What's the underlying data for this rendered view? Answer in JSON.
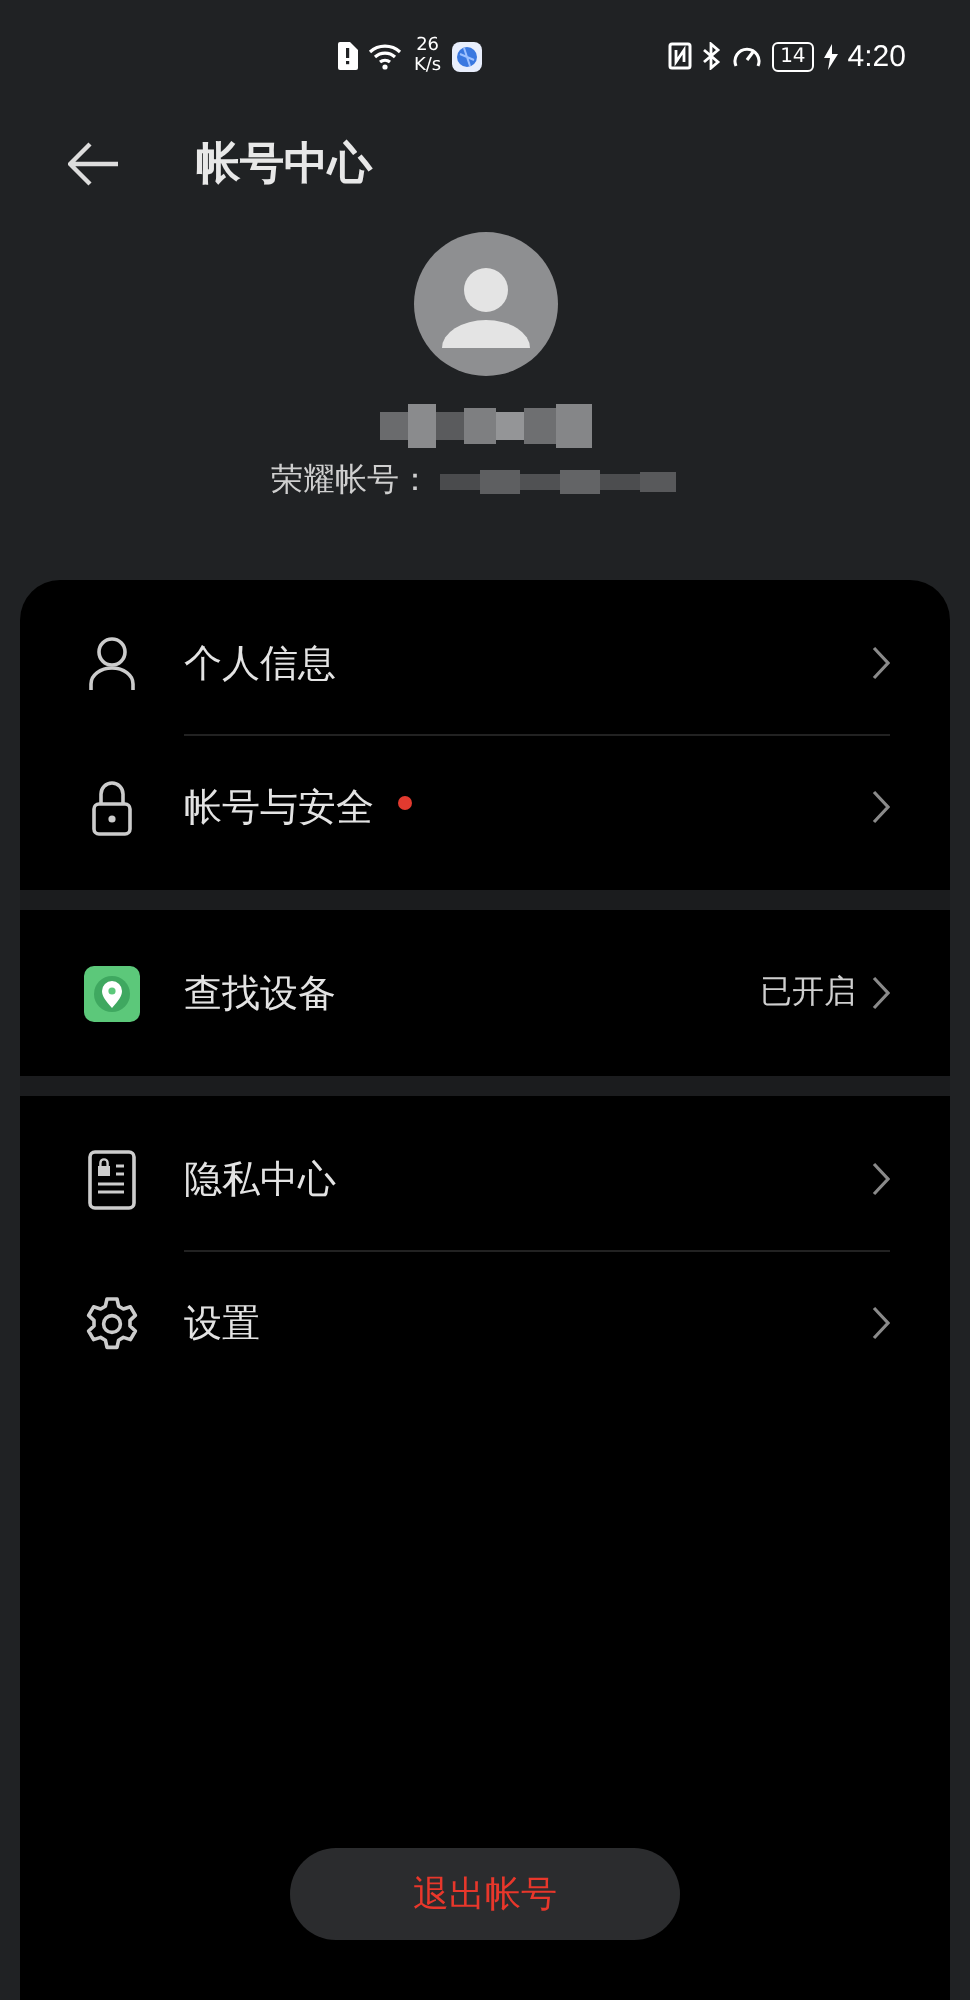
{
  "status_bar": {
    "speed_value": "26",
    "speed_unit": "K/s",
    "battery": "14",
    "time": "4:20"
  },
  "header": {
    "title": "帐号中心"
  },
  "account": {
    "id_label": "荣耀帐号："
  },
  "groups": [
    {
      "items": [
        {
          "kind": "person",
          "label": "个人信息",
          "badge": false
        },
        {
          "kind": "lock",
          "label": "帐号与安全",
          "badge": true
        }
      ]
    },
    {
      "items": [
        {
          "kind": "locator",
          "label": "查找设备",
          "badge": false,
          "value": "已开启"
        }
      ]
    },
    {
      "items": [
        {
          "kind": "privacy",
          "label": "隐私中心",
          "badge": false
        },
        {
          "kind": "gear",
          "label": "设置",
          "badge": false
        }
      ]
    }
  ],
  "logout_button": "退出帐号"
}
